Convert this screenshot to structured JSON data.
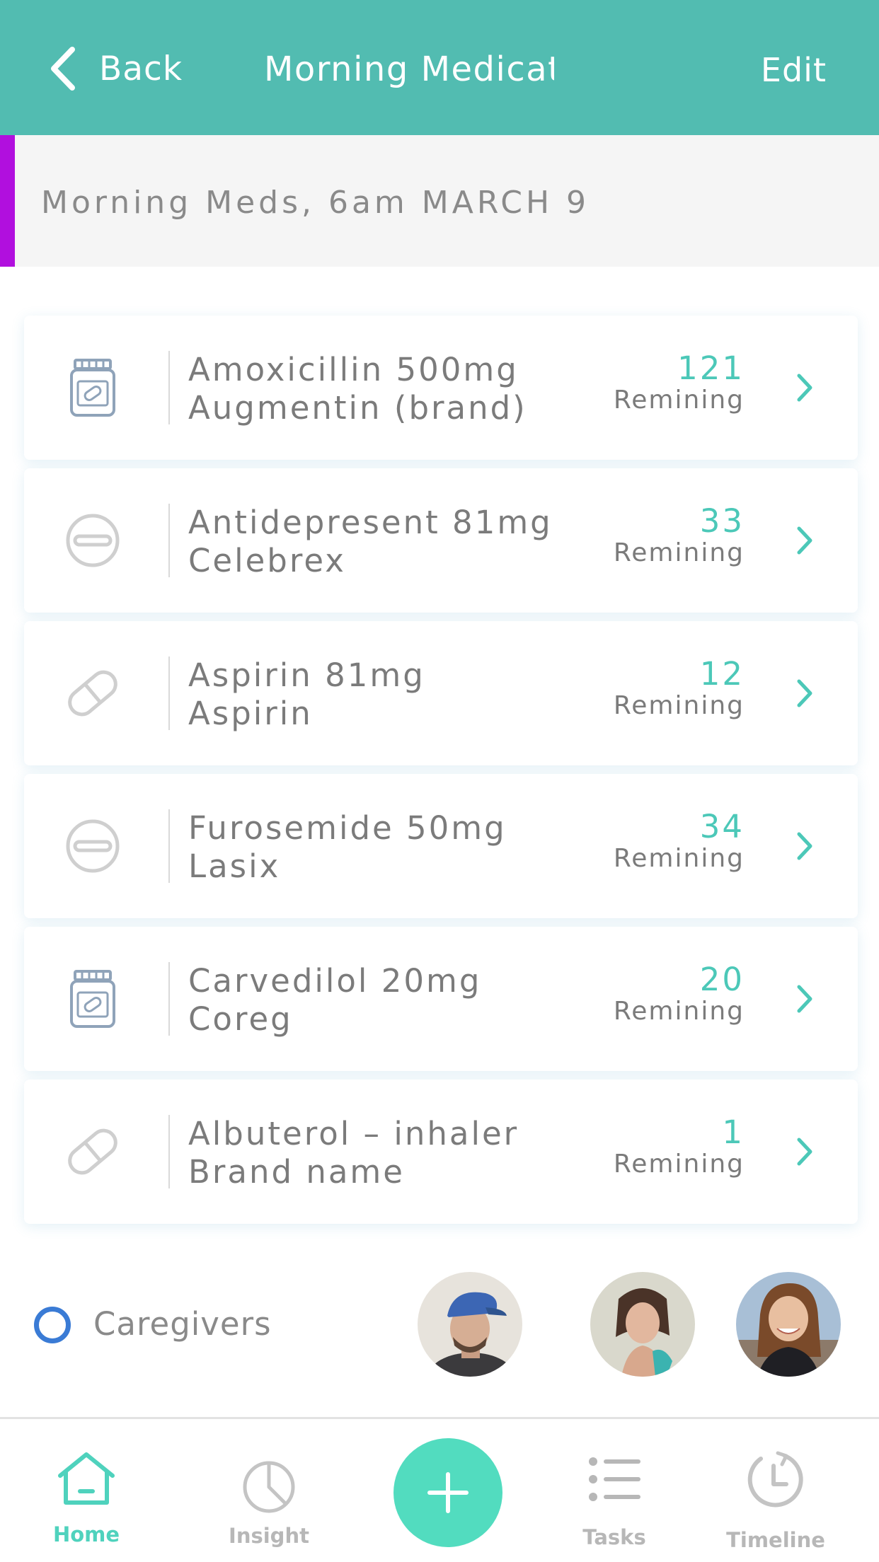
{
  "header": {
    "back_label": "Back",
    "title": "Morning Medicati",
    "edit_label": "Edit",
    "background_color": "#52bcb1"
  },
  "banner": {
    "text": "Morning Meds, 6am MARCH 9",
    "accent_color": "#b10fde"
  },
  "medications": [
    {
      "icon": "pill-bottle-icon",
      "name": "Amoxicillin 500mg",
      "brand": "Augmentin (brand)",
      "count": "121",
      "count_label": "Remining"
    },
    {
      "icon": "round-tablet-icon",
      "name": "Antidepresent 81mg",
      "brand": "Celebrex",
      "count": "33",
      "count_label": "Remining"
    },
    {
      "icon": "capsule-icon",
      "name": "Aspirin 81mg",
      "brand": "Aspirin",
      "count": "12",
      "count_label": "Remining"
    },
    {
      "icon": "round-tablet-icon",
      "name": "Furosemide 50mg",
      "brand": "Lasix",
      "count": "34",
      "count_label": "Remining"
    },
    {
      "icon": "pill-bottle-icon",
      "name": "Carvedilol 20mg",
      "brand": "Coreg",
      "count": "20",
      "count_label": "Remining"
    },
    {
      "icon": "capsule-icon",
      "name": "Albuterol – inhaler",
      "brand": "Brand name",
      "count": "1",
      "count_label": "Remining"
    }
  ],
  "caregivers": {
    "label": "Caregivers",
    "avatar_count": 3
  },
  "tabbar": {
    "tabs": [
      {
        "label": "Home",
        "icon": "home-icon",
        "active": true
      },
      {
        "label": "Insight",
        "icon": "pie-chart-icon",
        "active": false
      },
      {
        "label": "Tasks",
        "icon": "list-icon",
        "active": false
      },
      {
        "label": "Timeline",
        "icon": "clock-history-icon",
        "active": false
      }
    ],
    "add_icon": "plus-icon",
    "accent_color": "#52dcbf"
  }
}
